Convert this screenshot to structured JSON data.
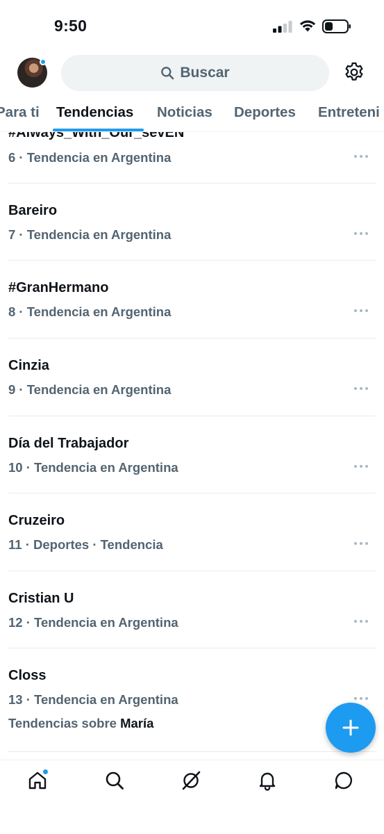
{
  "status_bar": {
    "time": "9:50"
  },
  "header": {
    "search_placeholder": "Buscar",
    "search_icon": "search-icon",
    "settings_icon": "gear-icon"
  },
  "tabs": [
    {
      "label": "Para ti",
      "active": false
    },
    {
      "label": "Tendencias",
      "active": true
    },
    {
      "label": "Noticias",
      "active": false
    },
    {
      "label": "Deportes",
      "active": false
    },
    {
      "label": "Entreteni",
      "active": false
    }
  ],
  "trends": [
    {
      "name": "#Always_With_Our_sevEN",
      "meta": "6 · Tendencia en Argentina"
    },
    {
      "name": "Bareiro",
      "meta": "7 · Tendencia en Argentina"
    },
    {
      "name": "#GranHermano",
      "meta": "8 · Tendencia en Argentina"
    },
    {
      "name": "Cinzia",
      "meta": "9 · Tendencia en Argentina"
    },
    {
      "name": "Día del Trabajador",
      "meta": "10 · Tendencia en Argentina"
    },
    {
      "name": "Cruzeiro",
      "meta": "11 · Deportes · Tendencia"
    },
    {
      "name": "Cristian U",
      "meta": "12 · Tendencia en Argentina"
    },
    {
      "name": "Closs",
      "meta": "13 · Tendencia en Argentina",
      "extra_prefix": "Tendencias sobre",
      "extra_name": "María"
    }
  ],
  "bottom_nav": [
    {
      "icon": "home-icon",
      "has_badge": true
    },
    {
      "icon": "search-icon",
      "has_badge": false
    },
    {
      "icon": "grok-icon",
      "has_badge": false
    },
    {
      "icon": "bell-icon",
      "has_badge": false
    },
    {
      "icon": "messages-icon",
      "has_badge": false
    }
  ],
  "colors": {
    "accent": "#1d9bf0",
    "text_primary": "#0f1419",
    "text_secondary": "#536471",
    "search_bg": "#eff3f4"
  }
}
